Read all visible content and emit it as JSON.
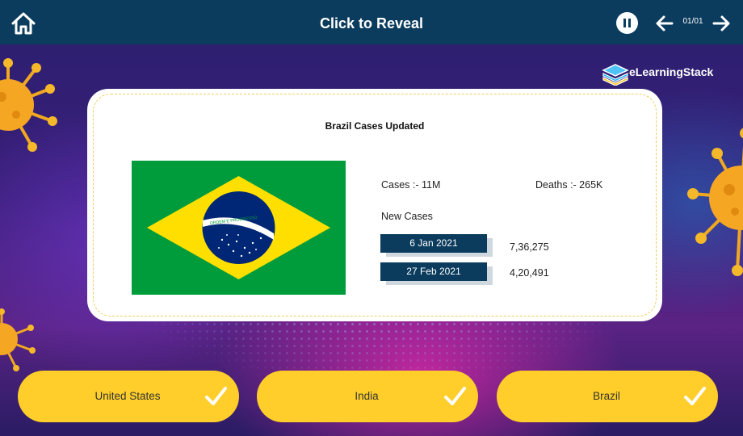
{
  "header": {
    "title": "Click to Reveal",
    "counter": "01/01"
  },
  "brand": {
    "logo_text": "eLearningStack"
  },
  "card": {
    "title": "Brazil Cases Updated",
    "cases": "Cases :- 11M",
    "deaths": "Deaths :- 265K",
    "new_cases_label": "New Cases",
    "rows": [
      {
        "date": "6 Jan 2021",
        "value": "7,36,275"
      },
      {
        "date": "27 Feb 2021",
        "value": "4,20,491"
      }
    ],
    "flag": {
      "country": "Brazil",
      "banner_text": "ORDEM E PROGRESSO"
    }
  },
  "choices": [
    {
      "label": "United States",
      "checked": true
    },
    {
      "label": "India",
      "checked": true
    },
    {
      "label": "Brazil",
      "checked": true
    }
  ],
  "icons": {
    "home": "home-icon",
    "pause": "pause-icon",
    "prev": "arrow-left-icon",
    "next": "arrow-right-icon",
    "check": "checkmark-icon"
  },
  "colors": {
    "header_bg": "#0b3c5d",
    "choice_bg": "#ffce2a",
    "date_box_bg": "#0b3c5d",
    "flag_green": "#009c3b",
    "flag_yellow": "#ffdf00",
    "flag_blue": "#002776"
  }
}
